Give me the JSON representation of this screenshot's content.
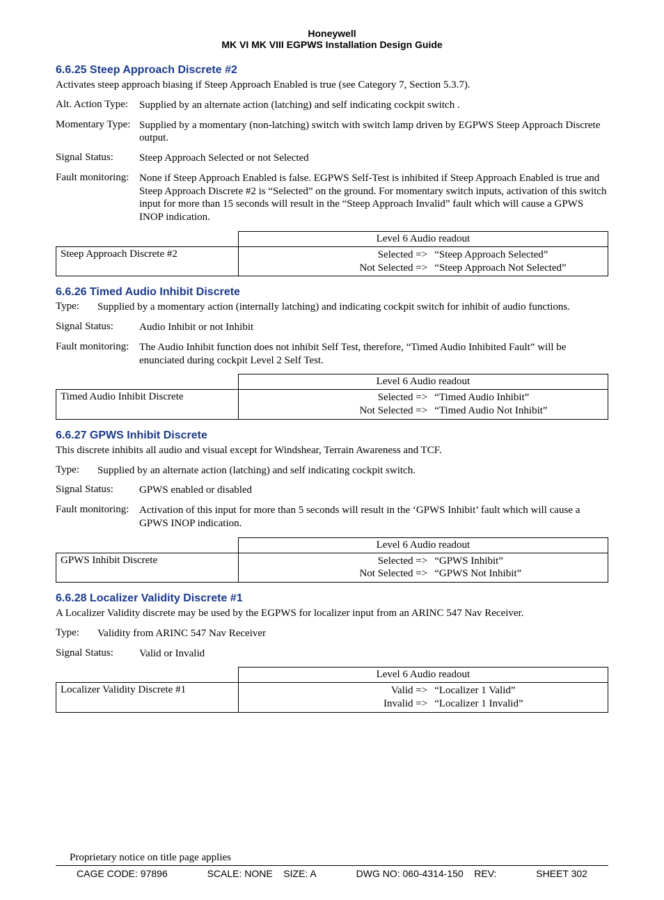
{
  "header": {
    "brand": "Honeywell",
    "doc_title": "MK VI  MK VIII EGPWS Installation Design Guide"
  },
  "sections": [
    {
      "number": "6.6.25",
      "title": "Steep Approach Discrete #2",
      "intro": "Activates steep approach biasing if Steep Approach Enabled is true (see Category 7, Section 5.3.7).",
      "defs": [
        {
          "label": "Alt. Action Type:",
          "body": "Supplied by an alternate action (latching) and self indicating cockpit switch .",
          "label_w": 120
        },
        {
          "label": "Momentary Type:",
          "body": "Supplied by a momentary (non-latching) switch with switch lamp driven by EGPWS Steep Approach Discrete output.",
          "label_w": 120,
          "indent": true
        },
        {
          "label": "Signal Status:",
          "body": "Steep Approach Selected or not Selected",
          "label_w": 120
        },
        {
          "label": "Fault monitoring:",
          "body": "None if Steep Approach Enabled is false.  EGPWS Self-Test is inhibited if Steep Approach Enabled is true and Steep Approach Discrete #2 is “Selected” on the ground. For momentary switch inputs, activation of this switch input for more than 15 seconds will result in the “Steep Approach Invalid” fault which will cause a GPWS INOP indication.",
          "label_w": 120
        }
      ],
      "table": {
        "header_right": "Level 6 Audio readout",
        "name": "Steep Approach Discrete #2",
        "rows": [
          {
            "left": "Selected =>",
            "right": "“Steep Approach Selected”"
          },
          {
            "left": "Not Selected =>",
            "right": "“Steep Approach Not Selected”"
          }
        ]
      }
    },
    {
      "number": "6.6.26",
      "title": "Timed Audio Inhibit Discrete",
      "defs": [
        {
          "label": "Type:",
          "body": "Supplied by a momentary action (internally latching) and indicating cockpit switch for inhibit of audio functions.",
          "label_w": 60
        },
        {
          "label": "Signal Status:",
          "body": "Audio Inhibit or not Inhibit",
          "label_w": 120
        },
        {
          "label": "Fault monitoring:",
          "body": "The Audio Inhibit function does not inhibit Self Test, therefore, “Timed Audio Inhibited Fault” will be enunciated during cockpit Level 2 Self Test.",
          "label_w": 120
        }
      ],
      "table": {
        "header_right": "Level 6 Audio readout",
        "name": "Timed Audio Inhibit Discrete",
        "rows": [
          {
            "left": "Selected =>",
            "right": "“Timed Audio Inhibit”"
          },
          {
            "left": "Not Selected =>",
            "right": "“Timed Audio Not Inhibit”"
          }
        ]
      }
    },
    {
      "number": "6.6.27",
      "title": "GPWS Inhibit Discrete",
      "intro": "This discrete inhibits all audio and visual except for Windshear, Terrain Awareness and TCF.",
      "defs": [
        {
          "label": "Type:",
          "body": "Supplied by an alternate action (latching) and self indicating cockpit switch.",
          "label_w": 60
        },
        {
          "label": "Signal Status:",
          "body": "GPWS enabled or disabled",
          "label_w": 120
        },
        {
          "label": "Fault monitoring:",
          "body": "Activation of this input for more than 5 seconds will result in the ‘GPWS Inhibit’ fault which will cause a GPWS INOP indication.",
          "label_w": 120
        }
      ],
      "table": {
        "header_right": "Level 6 Audio readout",
        "name": "GPWS Inhibit Discrete",
        "rows": [
          {
            "left": "Selected =>",
            "right": "“GPWS Inhibit”"
          },
          {
            "left": "Not Selected =>",
            "right": "“GPWS Not Inhibit”"
          }
        ]
      }
    },
    {
      "number": "6.6.28",
      "title": "Localizer Validity Discrete #1",
      "intro": "A Localizer Validity discrete may be used by the EGPWS for localizer input from an ARINC 547 Nav Receiver.",
      "defs": [
        {
          "label": "Type:",
          "body": "Validity from ARINC 547 Nav Receiver",
          "label_w": 60
        },
        {
          "label": "Signal Status:",
          "body": "Valid or Invalid",
          "label_w": 120
        }
      ],
      "table": {
        "header_right": "Level 6 Audio readout",
        "name": "Localizer Validity Discrete #1",
        "rows": [
          {
            "left": "Valid =>",
            "right": "“Localizer 1 Valid”"
          },
          {
            "left": "Invalid =>",
            "right": "“Localizer 1 Invalid”"
          }
        ]
      }
    }
  ],
  "footer": {
    "proprietary": "Proprietary notice on title page applies",
    "cage": "CAGE CODE: 97896",
    "scale": "SCALE: NONE",
    "size": "SIZE: A",
    "dwg": "DWG NO: 060-4314-150",
    "rev": "REV:",
    "sheet_label": "SHEET",
    "sheet_num": "302"
  }
}
